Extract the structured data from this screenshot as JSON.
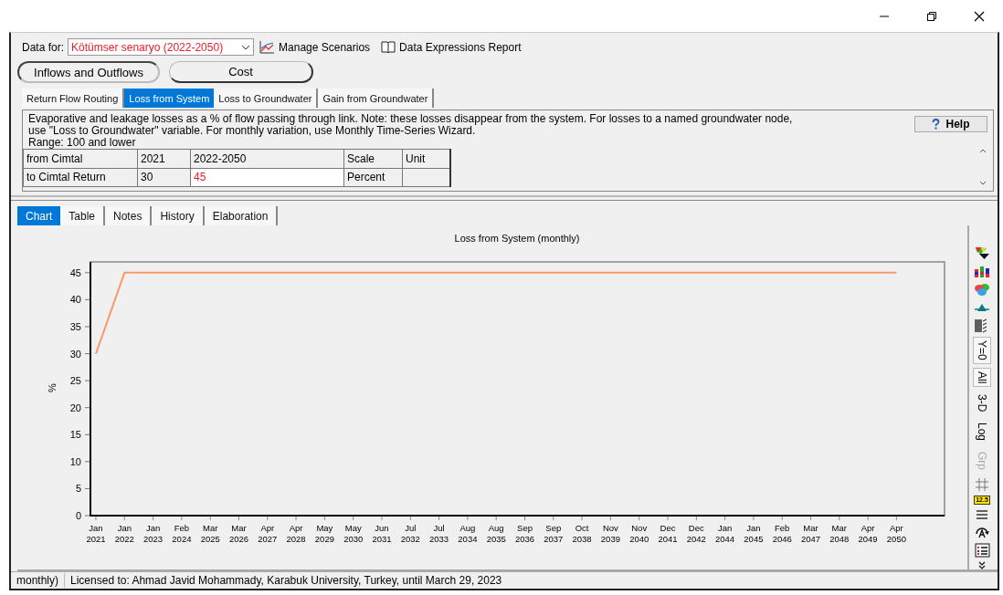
{
  "data_for": {
    "label": "Data for:",
    "value": "Kötümser senaryo (2022-2050)"
  },
  "links": [
    "Manage Scenarios",
    "Data Expressions Report"
  ],
  "categories": [
    {
      "label": "Inflows and Outflows",
      "selected": true
    },
    {
      "label": "Cost",
      "selected": false
    }
  ],
  "variable_tabs": [
    {
      "label": "Return Flow Routing",
      "selected": false
    },
    {
      "label": "Loss from System",
      "selected": true
    },
    {
      "label": "Loss to Groundwater",
      "selected": false
    },
    {
      "label": "Gain from Groundwater",
      "selected": false
    }
  ],
  "description": {
    "text": "Evaporative and leakage losses as a % of flow passing through link.  Note: these losses disappear from the system.  For losses to a named groundwater node, use \"Loss to Groundwater\" variable.  For monthly variation, use Monthly Time-Series Wizard.",
    "range": "Range: 100 and lower"
  },
  "help_button": "Help",
  "table": {
    "columns": [
      "from Cimtal",
      "2021",
      "2022-2050",
      "Scale",
      "Unit"
    ],
    "rows": [
      {
        "cells": [
          {
            "text": "to Cimtal Return",
            "modified": false
          },
          {
            "text": "30",
            "modified": false
          },
          {
            "text": "45",
            "modified": true
          },
          {
            "text": "Percent",
            "modified": false
          }
        ]
      }
    ]
  },
  "view_tabs": [
    {
      "label": "Chart",
      "selected": true
    },
    {
      "label": "Table",
      "selected": false
    },
    {
      "label": "Notes",
      "selected": false
    },
    {
      "label": "History",
      "selected": false
    },
    {
      "label": "Elaboration",
      "selected": false
    }
  ],
  "chart_data": {
    "type": "line",
    "title": "Loss from System (monthly)",
    "ylabel": "%",
    "categories": [
      "Jan 2021",
      "Jan 2022",
      "Jan 2023",
      "Feb 2024",
      "Mar 2025",
      "Mar 2026",
      "Apr 2027",
      "Apr 2028",
      "May 2029",
      "May 2030",
      "Jun 2031",
      "Jul 2032",
      "Jul 2033",
      "Aug 2034",
      "Aug 2035",
      "Sep 2036",
      "Sep 2037",
      "Oct 2038",
      "Nov 2039",
      "Nov 2040",
      "Dec 2041",
      "Dec 2042",
      "Jan 2044",
      "Jan 2045",
      "Feb 2046",
      "Mar 2047",
      "Mar 2048",
      "Apr 2049",
      "Apr 2050"
    ],
    "series": [
      {
        "color": "#f79a6a",
        "values": [
          30,
          45,
          45,
          45,
          45,
          45,
          45,
          45,
          45,
          45,
          45,
          45,
          45,
          45,
          45,
          45,
          45,
          45,
          45,
          45,
          45,
          45,
          45,
          45,
          45,
          45,
          45,
          45,
          45
        ]
      }
    ],
    "ylim": [
      0,
      47
    ],
    "yticks": [
      0,
      5,
      10,
      15,
      20,
      25,
      30,
      35,
      40,
      45
    ]
  },
  "chart_tools": [
    {
      "label": "Y=0",
      "pressed": true,
      "disabled": false
    },
    {
      "label": "All",
      "pressed": true,
      "disabled": false
    },
    {
      "label": "3-D",
      "pressed": false,
      "disabled": false
    },
    {
      "label": "Log",
      "pressed": false,
      "disabled": false
    },
    {
      "label": "Grp",
      "pressed": false,
      "disabled": true
    }
  ],
  "value_label": "12.5",
  "status_bar": [
    "monthly)",
    "Licensed to: Ahmad Javid Mohammady, Karabuk University, Turkey, until March 29, 2023"
  ]
}
